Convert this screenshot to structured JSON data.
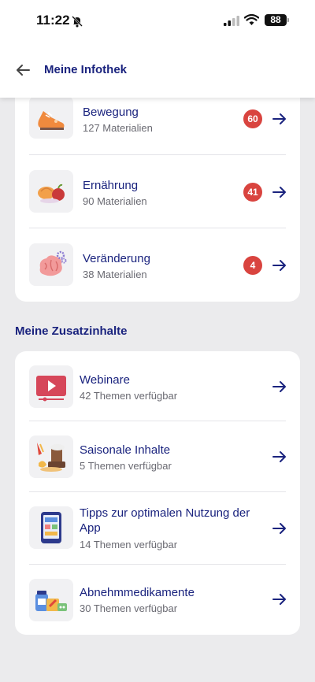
{
  "status_bar": {
    "time": "11:22",
    "battery": "88"
  },
  "header": {
    "title": "Meine Infothek"
  },
  "library": {
    "items": [
      {
        "title": "Bewegung",
        "subtitle": "127 Materialien",
        "badge": "60",
        "icon": "sneaker-icon"
      },
      {
        "title": "Ernährung",
        "subtitle": "90 Materialien",
        "badge": "41",
        "icon": "food-icon"
      },
      {
        "title": "Veränderung",
        "subtitle": "38 Materialien",
        "badge": "4",
        "icon": "brain-icon"
      }
    ]
  },
  "extras": {
    "title": "Meine Zusatzinhalte",
    "items": [
      {
        "title": "Webinare",
        "subtitle": "42 Themen verfügbar",
        "icon": "video-player-icon"
      },
      {
        "title": "Saisonale Inhalte",
        "subtitle": "5 Themen verfügbar",
        "icon": "seasonal-icon"
      },
      {
        "title": "Tipps zur optimalen Nutzung der App",
        "subtitle": "14 Themen verfügbar",
        "icon": "smartphone-icon"
      },
      {
        "title": "Abnehmmedikamente",
        "subtitle": "30 Themen verfügbar",
        "icon": "medication-icon"
      }
    ]
  },
  "colors": {
    "accent": "#1a237e",
    "badge": "#d9443f",
    "background": "#ebebed"
  }
}
